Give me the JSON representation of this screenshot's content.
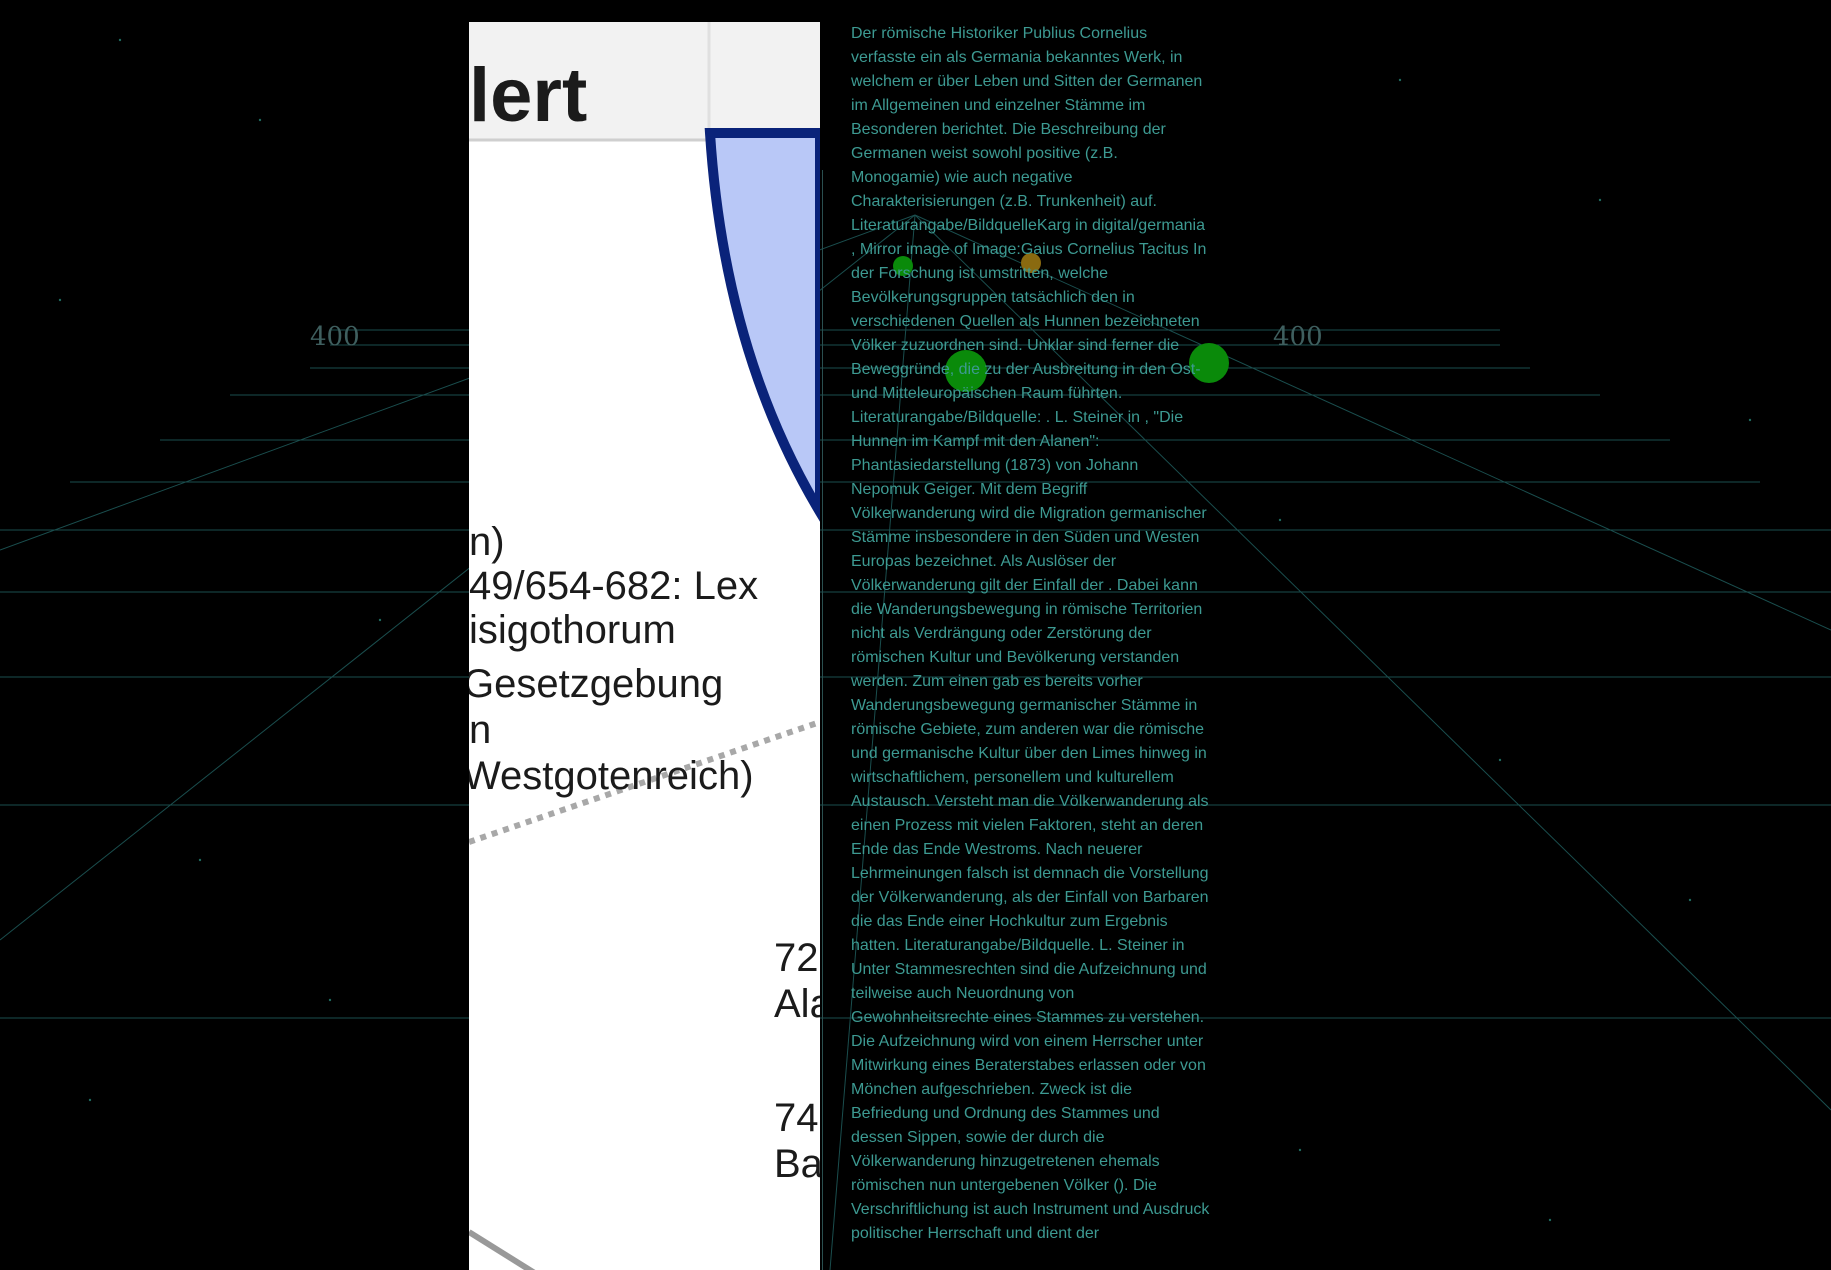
{
  "axis": {
    "left_label": "400",
    "right_label": "400"
  },
  "image_panel": {
    "header_fragment": "lert",
    "lines": [
      "n)",
      "49/654-682: Lex",
      "isigothorum",
      "Gesetzgebung",
      "n",
      "Westgotenreich)",
      "72",
      "Ala",
      "74",
      "Ba"
    ]
  },
  "article": {
    "text": "Der römische Historiker Publius Cornelius verfasste ein als Germania bekanntes Werk, in welchem er über Leben und Sitten der Germanen im Allgemeinen und einzelner Stämme im Besonderen berichtet. Die Beschreibung der Germanen weist sowohl positive (z.B. Monogamie) wie auch negative Charakterisierungen (z.B. Trunkenheit) auf. Literaturangabe/BildquelleKarg in digital/germania , Mirror image of Image:Gaius Cornelius Tacitus In der Forschung ist umstritten, welche Bevölkerungsgruppen tatsächlich den in verschiedenen Quellen als Hunnen bezeichneten Völker zuzuordnen sind. Unklar sind ferner die Beweggründe, die zu der Ausbreitung in den Ost- und Mitteleuropäischen Raum führten. Literaturangabe/Bildquelle: . L. Steiner in , \"Die Hunnen im Kampf mit den Alanen\": Phantasiedarstellung (1873) von Johann Nepomuk Geiger. Mit dem Begriff Völkerwanderung wird die Migration germanischer Stämme insbesondere in den Süden und Westen Europas bezeichnet. Als Auslöser der Völkerwanderung gilt der Einfall der . Dabei kann die Wanderungsbewegung in römische Territorien nicht als Verdrängung oder Zerstörung der römischen Kultur und Bevölkerung verstanden werden. Zum einen gab es bereits vorher Wanderungsbewegung germanischer Stämme in römische Gebiete, zum anderen war die römische und germanische Kultur über den Limes hinweg in wirtschaftlichem, personellem und kulturellem Austausch. Versteht man die Völkerwanderung als einen Prozess mit vielen Faktoren, steht an deren Ende das Ende Westroms. Nach neuerer Lehrmeinungen falsch ist demnach die Vorstellung der Völkerwanderung, als der Einfall von Barbaren die das Ende einer Hochkultur zum Ergebnis hatten. Literaturangabe/Bildquelle. L. Steiner in Unter Stammesrechten sind die Aufzeichnung und teilweise auch Neuordnung von Gewohnheitsrechte eines Stammes zu verstehen. Die Aufzeichnung wird von einem Herrscher unter Mitwirkung eines Beraterstabes erlassen oder von Mönchen aufgeschrieben. Zweck ist die Befriedung und Ordnung des Stammes und dessen Sippen, sowie der durch die Völkerwanderung hinzugetretenen ehemals römischen nun untergebenen Völker (). Die Verschriftlichung ist auch Instrument und Ausdruck politischer Herrschaft und dient der"
  },
  "colors": {
    "background": "#000000",
    "grid": "#1f5c5c",
    "article_text": "#3d9a92",
    "dot_green": "#0a8a0a",
    "dot_orange": "#8a6a10",
    "shape_fill": "#b9c8f7",
    "shape_stroke": "#0a237a"
  }
}
